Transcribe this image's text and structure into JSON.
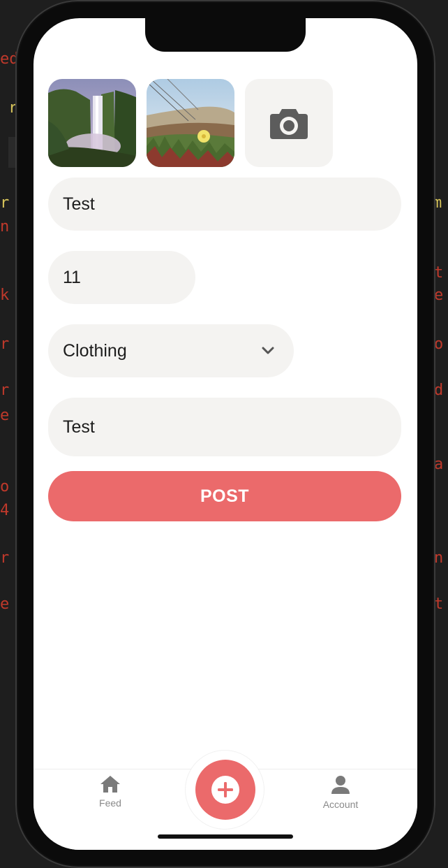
{
  "form": {
    "title_value": "Test",
    "price_value": "11",
    "category_value": "Clothing",
    "description_value": "Test"
  },
  "photos": [
    {
      "icon": "waterfall-photo"
    },
    {
      "icon": "beach-flower-photo"
    }
  ],
  "add_photo": {
    "icon": "camera-icon"
  },
  "post_button": {
    "label": "POST"
  },
  "tabbar": {
    "feed_label": "Feed",
    "account_label": "Account",
    "add_icon": "plus-icon"
  },
  "colors": {
    "accent": "#eb6a6b",
    "field_bg": "#f4f3f1",
    "tab_text": "#8a8a8a"
  }
}
